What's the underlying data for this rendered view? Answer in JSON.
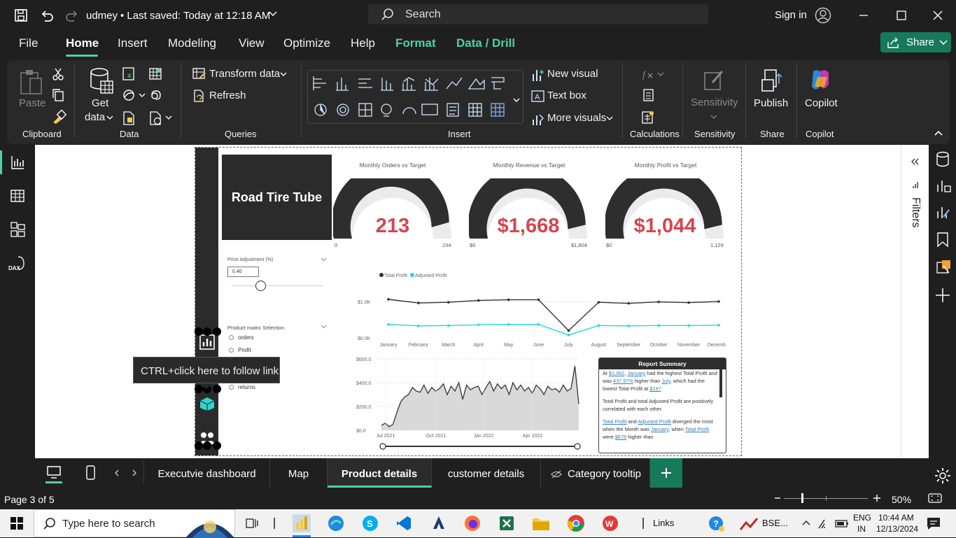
{
  "titlebar": {
    "file_name": "udmey",
    "saved_status": "•  Last saved: Today at 12:18 AM",
    "search_placeholder": "Search",
    "sign_in": "Sign in"
  },
  "menu": {
    "items": [
      "File",
      "Home",
      "Insert",
      "Modeling",
      "View",
      "Optimize",
      "Help",
      "Format",
      "Data / Drill"
    ],
    "share_label": "Share"
  },
  "ribbon": {
    "clipboard": {
      "paste": "Paste",
      "group": "Clipboard"
    },
    "data": {
      "get_data_1": "Get",
      "get_data_2": "data",
      "group": "Data"
    },
    "queries": {
      "transform": "Transform data",
      "refresh": "Refresh",
      "group": "Queries"
    },
    "insert": {
      "new_visual": "New visual",
      "text_box": "Text box",
      "more_visuals": "More visuals",
      "group": "Insert"
    },
    "calculations": {
      "group": "Calculations"
    },
    "sensitivity": {
      "label": "Sensitivity",
      "group": "Sensitivity"
    },
    "share": {
      "publish": "Publish",
      "group": "Share"
    },
    "copilot": {
      "label": "Copilot",
      "group": "Copilot"
    }
  },
  "report": {
    "title": "Road Tire Tube",
    "gauges": [
      {
        "title": "Monthly Orders vs Target",
        "value": "213",
        "min": "0",
        "max": "234",
        "fraction": 0.91
      },
      {
        "title": "Monthly Revenue vs Target",
        "value": "$1,668",
        "min": "$0",
        "max": "$1,804",
        "fraction": 0.925
      },
      {
        "title": "Monthly Profit vs Target",
        "value": "$1,044",
        "min": "$0",
        "max": "1,129",
        "fraction": 0.925
      }
    ],
    "price_adjustment": {
      "label": "Price Adjustment (%)",
      "value": "0.40"
    },
    "metric_selection": {
      "label": "Product matric Selection",
      "options": [
        "orders",
        "Profit",
        "returns"
      ]
    },
    "summary": {
      "title": "Report Summary",
      "p1_a": "At ",
      "p1_v1": "$1,062",
      "p1_b": ", ",
      "p1_v2": "January",
      "p1_c": " had the highest Total Profit and was ",
      "p1_v3": "437.97%",
      "p1_d": " higher than ",
      "p1_v4": "July",
      "p1_e": ", which had the lowest Total Profit at ",
      "p1_v5": "$197",
      "p1_f": ".",
      "p2": "Total Profit and total Adjusted Profit are positively correlated with each other.",
      "p3_v1": "Total Profit",
      "p3_a": " and ",
      "p3_v2": "Adjusted Profit",
      "p3_b": " diverged the most when the Month was ",
      "p3_v3": "January",
      "p3_c": ", when ",
      "p3_v4": "Total Profit",
      "p3_d": " were ",
      "p3_v5": "$678",
      "p3_e": " higher than"
    }
  },
  "tooltip": "CTRL+click here to follow link",
  "chart_data": [
    {
      "type": "line",
      "legend": [
        "Total Profit",
        "Adjusted Profit"
      ],
      "categories": [
        "January",
        "February",
        "March",
        "April",
        "May",
        "June",
        "July",
        "August",
        "September",
        "October",
        "November",
        "December"
      ],
      "yticks": [
        "$1.0K",
        "$0.0K"
      ],
      "ylim": [
        0,
        1.0
      ],
      "series": [
        {
          "name": "Total Profit",
          "color": "#333333",
          "values": [
            1.06,
            0.96,
            0.98,
            1.03,
            1.05,
            1.05,
            0.2,
            0.98,
            0.95,
            0.99,
            0.97,
            1.0
          ]
        },
        {
          "name": "Adjusted Profit",
          "color": "#2ad8d0",
          "values": [
            0.37,
            0.33,
            0.34,
            0.36,
            0.37,
            0.37,
            0.08,
            0.34,
            0.33,
            0.34,
            0.34,
            0.35
          ]
        }
      ]
    },
    {
      "type": "area",
      "xticks": [
        "Jul 2021",
        "Oct 2021",
        "Jan 2022",
        "Apr 2022"
      ],
      "yticks": [
        "$600.0",
        "$400.0",
        "$200.0",
        "$0.0"
      ],
      "ylim": [
        0,
        600
      ],
      "series": [
        {
          "name": "",
          "color": "#333333",
          "values": [
            40,
            60,
            30,
            50,
            150,
            240,
            280,
            300,
            360,
            330,
            320,
            380,
            310,
            360,
            330,
            350,
            390,
            300,
            370,
            330,
            400,
            260,
            380,
            340,
            360,
            370,
            300,
            360,
            410,
            330,
            390,
            350,
            380,
            300,
            400,
            340,
            380,
            330,
            360,
            310,
            380,
            350,
            300,
            370,
            340,
            350,
            320,
            380,
            330,
            350,
            540,
            220
          ]
        }
      ]
    }
  ],
  "page_tabs": [
    "Executvie dashboard",
    "Map",
    "Product details",
    "customer details",
    "Category tooltip"
  ],
  "status": {
    "page": "Page 3 of 5",
    "zoom": "50%"
  },
  "taskbar": {
    "search_placeholder": "Type here to search",
    "links": "Links",
    "stock": "BSE...",
    "lang1": "ENG",
    "lang2": "IN",
    "time": "10:44 AM",
    "date": "12/13/2024"
  }
}
